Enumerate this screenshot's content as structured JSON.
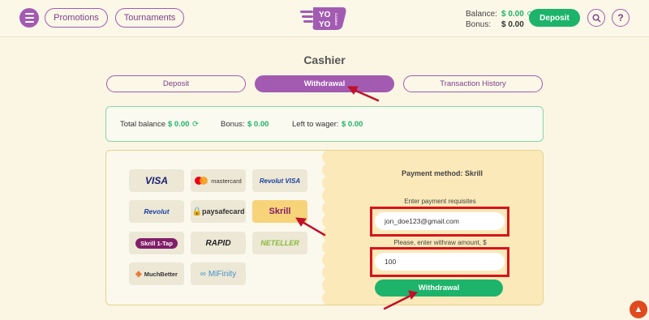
{
  "header": {
    "promotions_label": "Promotions",
    "tournaments_label": "Tournaments",
    "logo_text": "YO YO CASINO",
    "balance_label": "Balance:",
    "balance_value": "$ 0.00",
    "bonus_label": "Bonus:",
    "bonus_value": "$ 0.00",
    "deposit_label": "Deposit",
    "help_label": "?"
  },
  "page_title": "Cashier",
  "tabs": [
    {
      "label": "Deposit"
    },
    {
      "label": "Withdrawal"
    },
    {
      "label": "Transaction History"
    }
  ],
  "summary": {
    "total_balance_label": "Total balance",
    "total_balance_value": "$ 0.00",
    "bonus_label": "Bonus:",
    "bonus_value": "$ 0.00",
    "wager_label": "Left to wager:",
    "wager_value": "$ 0.00"
  },
  "methods": [
    {
      "label": "VISA"
    },
    {
      "label": "mastercard"
    },
    {
      "label": "Revolut VISA"
    },
    {
      "label": "Revolut"
    },
    {
      "label": "paysafecard"
    },
    {
      "label": "Skrill"
    },
    {
      "label": "Skrill 1-Tap"
    },
    {
      "label": "RAPID"
    },
    {
      "label": "NETELLER"
    },
    {
      "label": "MuchBetter"
    },
    {
      "label": "MiFinity"
    }
  ],
  "form": {
    "method_title": "Payment method: Skrill",
    "requisites_label": "Enter payment requisites",
    "requisites_value": "jon_doe123@gmail.com",
    "amount_label": "Please, enter withraw amount, $",
    "amount_value": "100",
    "submit_label": "Withdrawal"
  },
  "colors": {
    "accent_purple": "#a35bb2",
    "accent_green": "#1db36b",
    "highlight_red": "#d8141b"
  }
}
